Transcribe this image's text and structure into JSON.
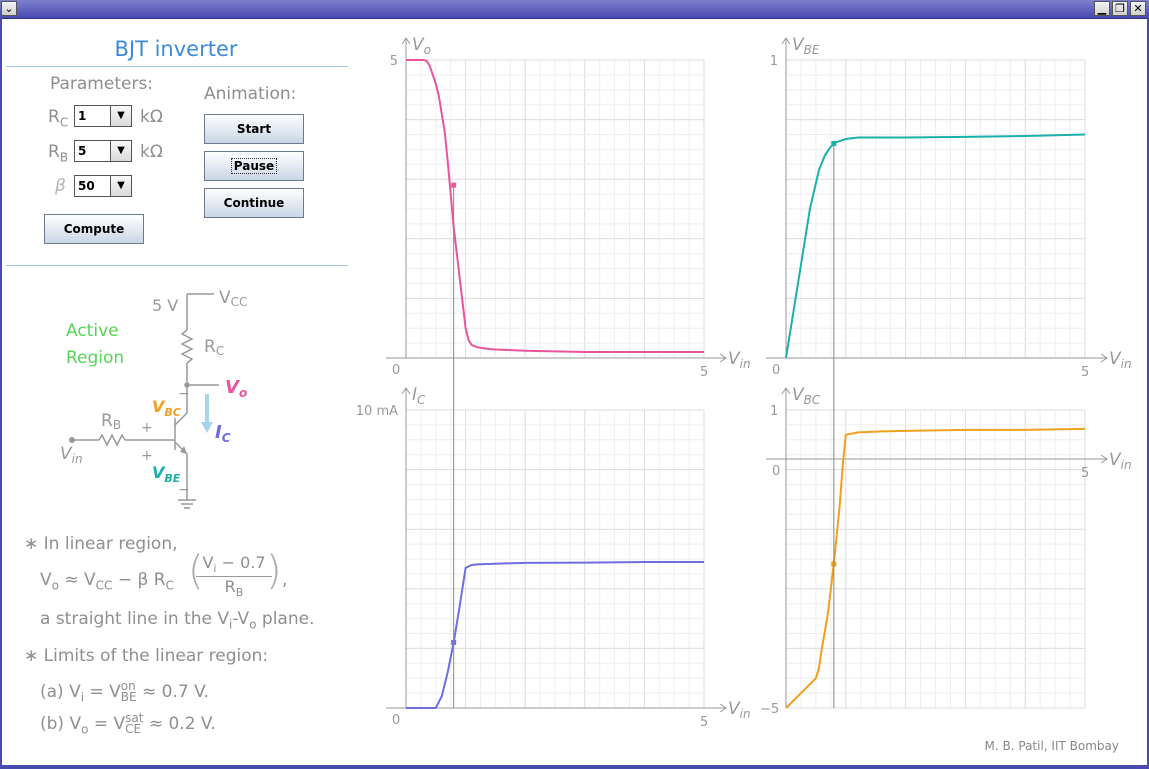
{
  "window": {
    "menu_glyph": "⌄",
    "minimize": "▁",
    "restore": "❐",
    "close": "✕"
  },
  "title": "BJT inverter",
  "parameters": {
    "heading": "Parameters:",
    "rc": {
      "label": "R",
      "sub": "C",
      "value": "1",
      "unit": "kΩ"
    },
    "rb": {
      "label": "R",
      "sub": "B",
      "value": "5",
      "unit": "kΩ"
    },
    "beta": {
      "label": "β",
      "value": "50"
    },
    "compute_label": "Compute"
  },
  "animation": {
    "heading": "Animation:",
    "start_label": "Start",
    "pause_label": "Pause",
    "continue_label": "Continue"
  },
  "circuit": {
    "region": "Active\nRegion",
    "supply": "5 V",
    "vcc": "V",
    "vcc_sub": "CC",
    "rc": "R",
    "rc_sub": "C",
    "rb": "R",
    "rb_sub": "B",
    "vo": "V",
    "vo_sub": "o",
    "vbc": "V",
    "vbc_sub": "BC",
    "vbe": "V",
    "vbe_sub": "BE",
    "ic": "I",
    "ic_sub": "C",
    "vin": "V",
    "vin_sub": "in",
    "plus": "+",
    "minus": "−",
    "colors": {
      "vo": "#e8559c",
      "vbc": "#f0a020",
      "vbe": "#1bb0a8",
      "ic": "#6e6ee0",
      "region": "#57d457"
    }
  },
  "notes": {
    "n1": "∗ In linear region,",
    "n2a": "V",
    "n2b": "o",
    "n2c": " ≈ V",
    "n2d": "CC",
    "n2e": " − β R",
    "n2f": "C",
    "frac_num": "V",
    "frac_num_sub": "i",
    "frac_num_rest": " − 0.7",
    "frac_den": "R",
    "frac_den_sub": "B",
    "n2tail": ",",
    "n3": "a straight line in the V",
    "n3sub1": "i",
    "n3mid": "-V",
    "n3sub2": "o",
    "n3end": " plane.",
    "n4": "∗ Limits of the linear region:",
    "n5a": "(a) V",
    "n5sub": "i",
    "n5b": " = V",
    "n5sup": "on",
    "n5sub2": "BE",
    "n5c": " ≈ 0.7 V.",
    "n6a": "(b) V",
    "n6sub": "o",
    "n6b": " = V",
    "n6sup": "sat",
    "n6sub2": "CE",
    "n6c": " ≈ 0.2 V."
  },
  "author": "M. B. Patil, IIT Bombay",
  "chart_data": [
    {
      "type": "line",
      "id": "vo",
      "ylabel": "V",
      "ylabel_sub": "o",
      "xlabel": "V",
      "xlabel_sub": "in",
      "xlim": [
        0,
        5
      ],
      "ylim": [
        0,
        5
      ],
      "xticks": [
        "0",
        "5"
      ],
      "yticks": [
        "5"
      ],
      "color": "#e8559c",
      "x": [
        0,
        0.2,
        0.3,
        0.35,
        0.4,
        0.5,
        0.55,
        0.65,
        0.7,
        0.8,
        1.0,
        1.05,
        1.1,
        1.2,
        1.4,
        1.6,
        2,
        2.5,
        3,
        4,
        5
      ],
      "y": [
        5,
        5,
        5,
        4.98,
        4.9,
        4.6,
        4.4,
        3.8,
        3.3,
        2.2,
        0.5,
        0.3,
        0.22,
        0.18,
        0.15,
        0.14,
        0.12,
        0.11,
        0.1,
        0.1,
        0.1
      ],
      "marker": {
        "x": 0.8,
        "y": 2.9
      }
    },
    {
      "type": "line",
      "id": "vbe",
      "ylabel": "V",
      "ylabel_sub": "BE",
      "xlabel": "V",
      "xlabel_sub": "in",
      "xlim": [
        0,
        5
      ],
      "ylim": [
        0,
        1
      ],
      "xticks": [
        "0",
        "5"
      ],
      "yticks": [
        "1"
      ],
      "color": "#1bb0a8",
      "x": [
        0,
        0.4,
        0.55,
        0.65,
        0.75,
        0.85,
        0.9,
        1.0,
        1.2,
        1.6,
        2,
        3,
        4,
        5
      ],
      "y": [
        0,
        0.5,
        0.63,
        0.68,
        0.71,
        0.725,
        0.728,
        0.735,
        0.74,
        0.74,
        0.74,
        0.742,
        0.745,
        0.75
      ],
      "marker": {
        "x": 0.8,
        "y": 0.72
      }
    },
    {
      "type": "line",
      "id": "ic",
      "ylabel": "I",
      "ylabel_sub": "C",
      "xlabel": "V",
      "xlabel_sub": "in",
      "xlim": [
        0,
        5
      ],
      "ylim": [
        0,
        10
      ],
      "xticks": [
        "0",
        "5"
      ],
      "yticks": [
        "10 mA"
      ],
      "color": "#6e6ee0",
      "x": [
        0,
        0.5,
        0.6,
        0.7,
        0.8,
        0.9,
        1.0,
        1.1,
        1.2,
        1.6,
        2,
        3,
        4,
        5
      ],
      "y": [
        0,
        0,
        0.4,
        1.2,
        2.2,
        3.4,
        4.7,
        4.8,
        4.82,
        4.85,
        4.87,
        4.88,
        4.9,
        4.9
      ],
      "marker": {
        "x": 0.8,
        "y": 2.2
      }
    },
    {
      "type": "line",
      "id": "vbc",
      "ylabel": "V",
      "ylabel_sub": "BC",
      "xlabel": "V",
      "xlabel_sub": "in",
      "xlim": [
        0,
        5
      ],
      "ylim": [
        -5,
        1
      ],
      "xticks": [
        "0",
        "5"
      ],
      "yticks": [
        "1",
        "0",
        "−5"
      ],
      "color": "#f0a020",
      "x": [
        0,
        0.5,
        0.55,
        0.6,
        0.7,
        0.8,
        0.9,
        0.95,
        1.0,
        1.2,
        1.6,
        2,
        3,
        4,
        5
      ],
      "y": [
        -5,
        -4.4,
        -4.2,
        -3.8,
        -3.1,
        -2.1,
        -0.9,
        -0.1,
        0.5,
        0.55,
        0.57,
        0.58,
        0.6,
        0.6,
        0.62
      ],
      "marker": {
        "x": 0.8,
        "y": -2.1
      }
    }
  ]
}
